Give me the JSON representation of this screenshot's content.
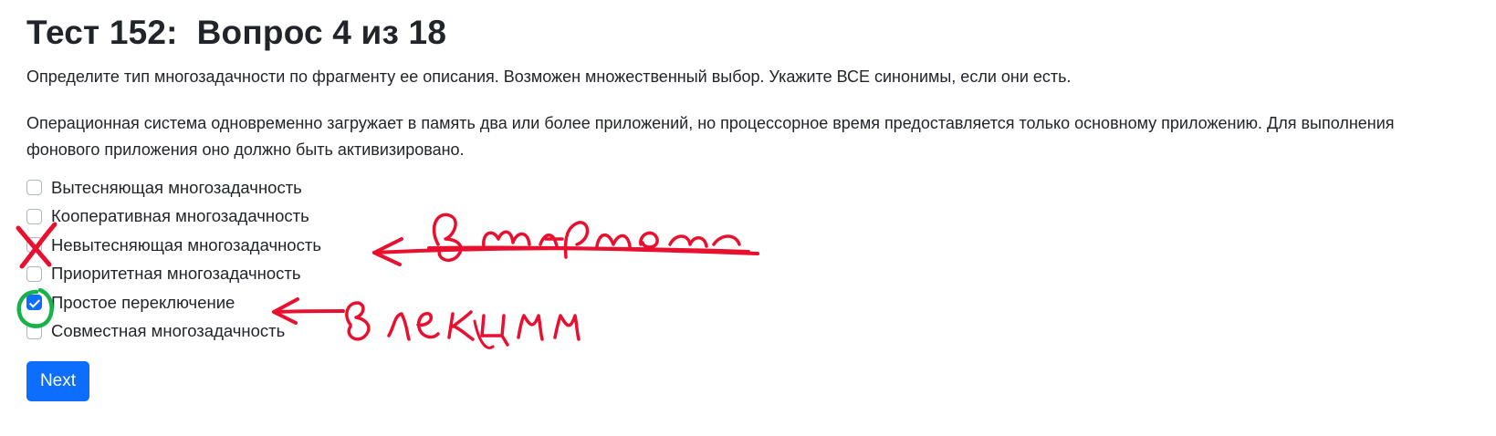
{
  "quiz": {
    "title": "Тест 152:  Вопрос 4 из 18",
    "instruction": "Определите тип многозадачности по фрагменту ее описания. Возможен множественный выбор. Укажите ВСЕ синонимы, если они есть.",
    "question": "Операционная система одновременно загружает в память два или более приложений, но процессорное время предоставляется только основному приложению. Для выполнения фонового приложения оно должно быть активизировано.",
    "options": [
      {
        "label": "Вытесняющая многозадачность",
        "checked": false
      },
      {
        "label": "Кооперативная многозадачность",
        "checked": false
      },
      {
        "label": "Невытесняющая многозадачность",
        "checked": false
      },
      {
        "label": "Приоритетная многозадачность",
        "checked": false
      },
      {
        "label": "Простое переключение",
        "checked": true
      },
      {
        "label": "Совместная многозадачность",
        "checked": false
      }
    ],
    "next_label": "Next"
  },
  "colors": {
    "primary": "#0d6efd",
    "annotation_red": "#e8102e",
    "annotation_green": "#19b24a"
  }
}
